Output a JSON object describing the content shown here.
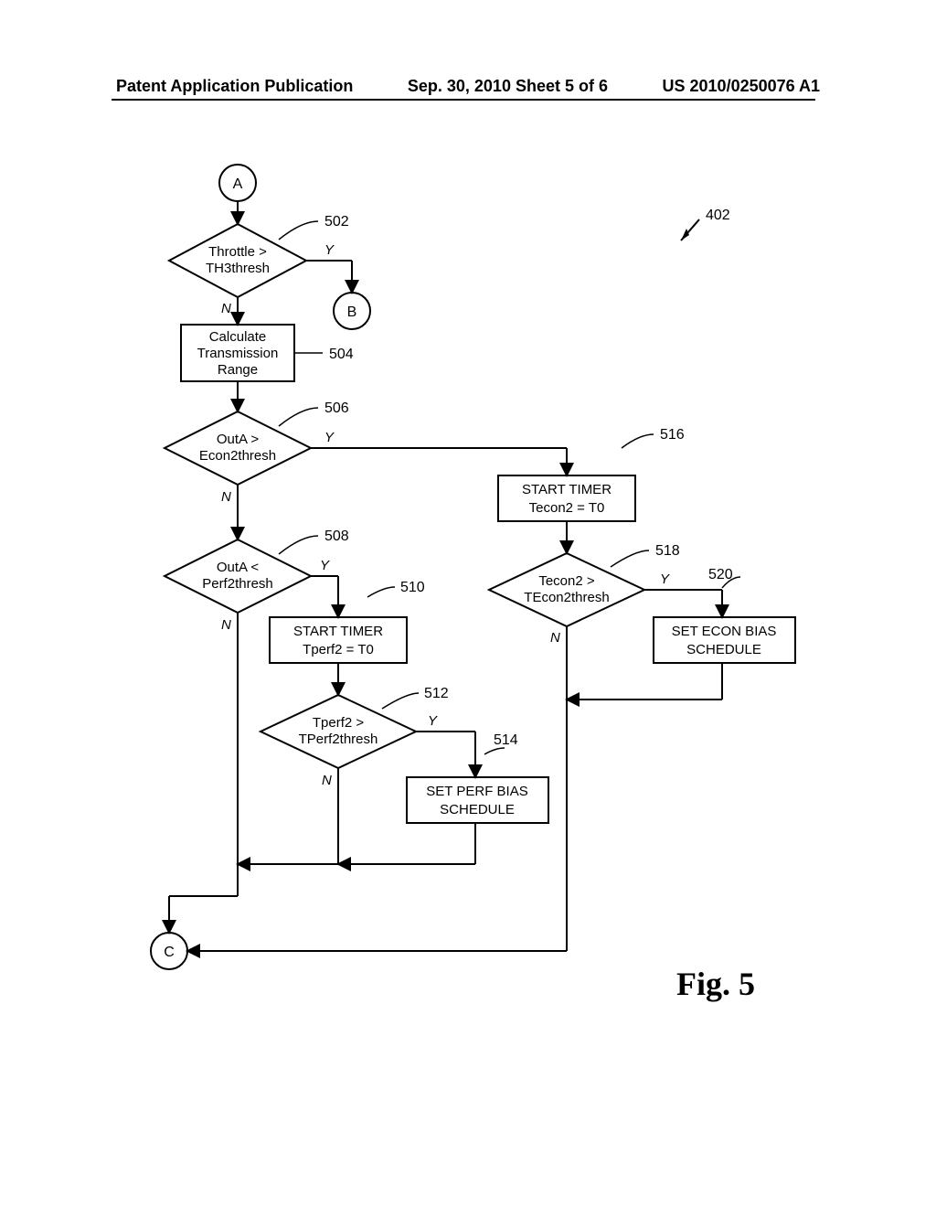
{
  "header": {
    "left": "Patent Application Publication",
    "center": "Sep. 30, 2010  Sheet 5 of 6",
    "right": "US 2010/0250076 A1"
  },
  "figure_label": "Fig. 5",
  "nodes": {
    "connA": "A",
    "connB": "B",
    "connC": "C",
    "d502": {
      "l1": "Throttle >",
      "l2": "TH3thresh"
    },
    "p504": {
      "l1": "Calculate",
      "l2": "Transmission",
      "l3": "Range"
    },
    "d506": {
      "l1": "OutA >",
      "l2": "Econ2thresh"
    },
    "d508": {
      "l1": "OutA <",
      "l2": "Perf2thresh"
    },
    "p510": {
      "l1": "START TIMER",
      "l2": "Tperf2 = T0"
    },
    "d512": {
      "l1": "Tperf2 >",
      "l2": "TPerf2thresh"
    },
    "p514": {
      "l1": "SET PERF BIAS",
      "l2": "SCHEDULE"
    },
    "p516": {
      "l1": "START TIMER",
      "l2": "Tecon2 = T0"
    },
    "d518": {
      "l1": "Tecon2 >",
      "l2": "TEcon2thresh"
    },
    "p520": {
      "l1": "SET ECON BIAS",
      "l2": "SCHEDULE"
    }
  },
  "refnums": {
    "r402": "402",
    "r502": "502",
    "r504": "504",
    "r506": "506",
    "r508": "508",
    "r510": "510",
    "r512": "512",
    "r514": "514",
    "r516": "516",
    "r518": "518",
    "r520": "520"
  },
  "edge_labels": {
    "Y": "Y",
    "N": "N"
  }
}
